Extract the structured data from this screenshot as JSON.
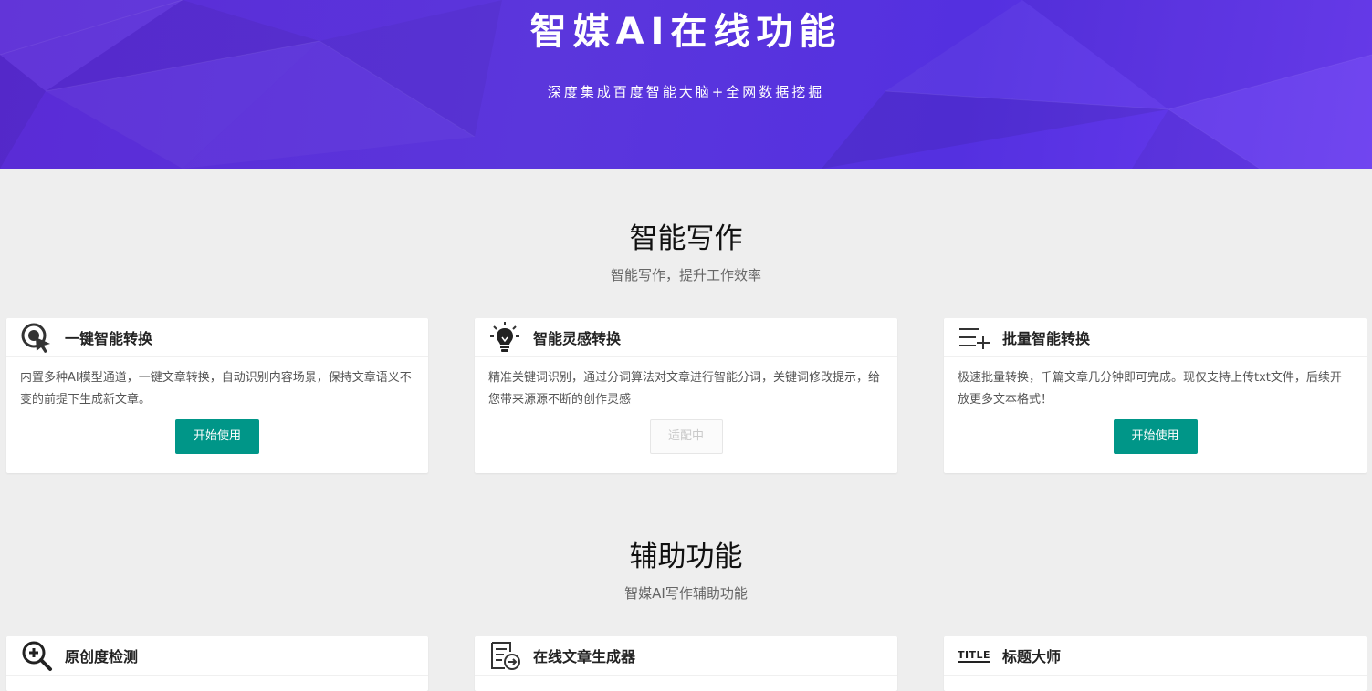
{
  "hero": {
    "title": "智媒AI在线功能",
    "subtitle": "深度集成百度智能大脑+全网数据挖掘"
  },
  "sections": [
    {
      "title": "智能写作",
      "subtitle": "智能写作，提升工作效率",
      "cards": [
        {
          "icon": "click-cursor-icon",
          "title": "一键智能转换",
          "desc": "内置多种AI模型通道，一键文章转换，自动识别内容场景，保持文章语义不变的前提下生成新文章。",
          "button": "开始使用"
        },
        {
          "icon": "lightbulb-icon",
          "title": "智能灵感转换",
          "desc": "精准关键词识别，通过分词算法对文章进行智能分词，关键词修改提示，给您带来源源不断的创作灵感",
          "button": "适配中"
        },
        {
          "icon": "list-add-icon",
          "title": "批量智能转换",
          "desc": "极速批量转换，千篇文章几分钟即可完成。现仅支持上传txt文件，后续开放更多文本格式！",
          "button": "开始使用"
        }
      ]
    },
    {
      "title": "辅助功能",
      "subtitle": "智媒AI写作辅助功能",
      "cards": [
        {
          "icon": "zoom-in-icon",
          "title": "原创度检测"
        },
        {
          "icon": "document-arrow-icon",
          "title": "在线文章生成器"
        },
        {
          "icon": "title-text-icon",
          "icon_text": "TITLE",
          "title": "标题大师"
        }
      ]
    }
  ],
  "colors": {
    "hero_start": "#5a2bd6",
    "hero_end": "#6a3cf0",
    "button_primary": "#009688",
    "background": "#eeeeee"
  }
}
